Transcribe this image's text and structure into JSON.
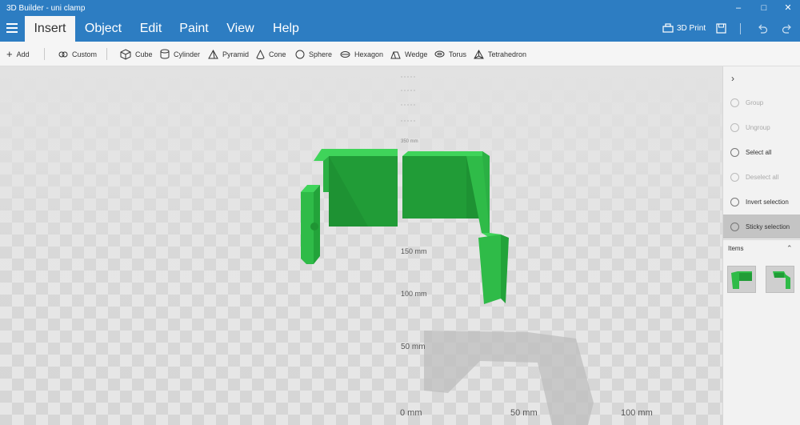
{
  "window": {
    "title": "3D Builder - uni clamp",
    "controls": {
      "minimize": "–",
      "maximize": "□",
      "close": "✕"
    }
  },
  "tabs": [
    {
      "label": "Insert",
      "active": true
    },
    {
      "label": "Object",
      "active": false
    },
    {
      "label": "Edit",
      "active": false
    },
    {
      "label": "Paint",
      "active": false
    },
    {
      "label": "View",
      "active": false
    },
    {
      "label": "Help",
      "active": false
    }
  ],
  "ribbon_right": {
    "print_label": "3D Print"
  },
  "toolbar": {
    "add": "Add",
    "custom": "Custom",
    "shapes": [
      "Cube",
      "Cylinder",
      "Pyramid",
      "Cone",
      "Sphere",
      "Hexagon",
      "Wedge",
      "Torus",
      "Tetrahedron"
    ]
  },
  "viewport": {
    "ruler_vertical": [
      "150 mm",
      "100 mm",
      "50 mm"
    ],
    "ruler_horizontal": [
      "0 mm",
      "50 mm",
      "100 mm"
    ],
    "ruler_faded": [
      "350 mm"
    ],
    "model_color": "#2fb84a"
  },
  "sidepanel": {
    "actions": [
      {
        "label": "Group",
        "enabled": false
      },
      {
        "label": "Ungroup",
        "enabled": false
      },
      {
        "label": "Select all",
        "enabled": true
      },
      {
        "label": "Deselect all",
        "enabled": false
      },
      {
        "label": "Invert selection",
        "enabled": true
      },
      {
        "label": "Sticky selection",
        "enabled": true,
        "active": true
      }
    ],
    "items_header": "Items",
    "item_count": 2
  }
}
